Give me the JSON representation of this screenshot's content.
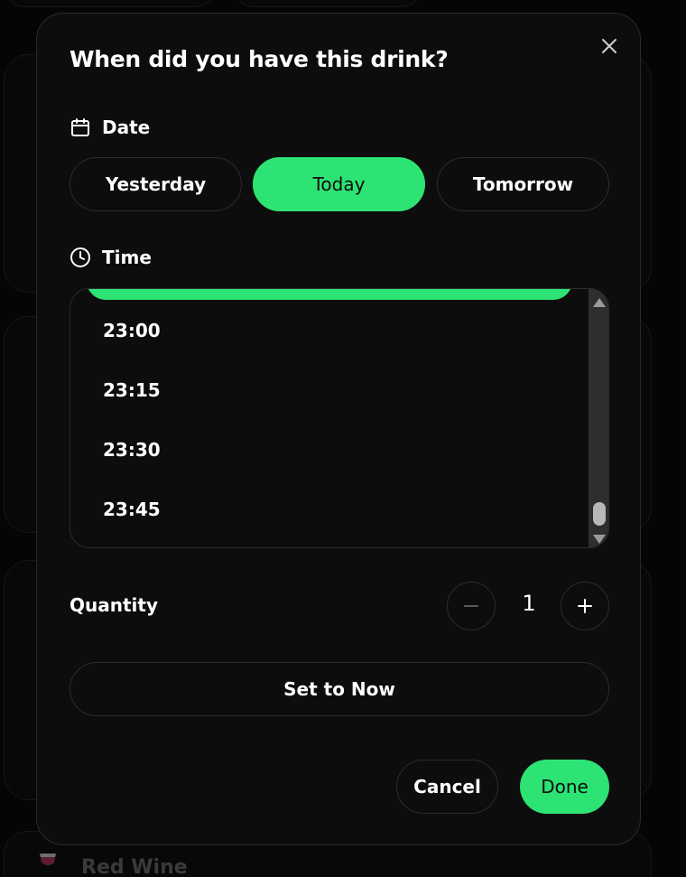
{
  "background": {
    "item_label": "Red Wine",
    "item_icon": "wine-glass-icon"
  },
  "modal": {
    "title": "When did you have this drink?",
    "close_icon": "close-icon"
  },
  "date": {
    "label": "Date",
    "icon": "calendar-icon",
    "options": [
      "Yesterday",
      "Today",
      "Tomorrow"
    ],
    "selected": "Today"
  },
  "time": {
    "label": "Time",
    "icon": "clock-icon",
    "items": [
      "23:00",
      "23:15",
      "23:30",
      "23:45"
    ]
  },
  "quantity": {
    "label": "Quantity",
    "value": "1",
    "minus_icon": "minus-icon",
    "plus_icon": "plus-icon"
  },
  "actions": {
    "set_to_now": "Set to Now",
    "cancel": "Cancel",
    "done": "Done"
  },
  "colors": {
    "accent": "#2de374",
    "surface": "#0d0d0d",
    "border": "#2c2c2c"
  }
}
